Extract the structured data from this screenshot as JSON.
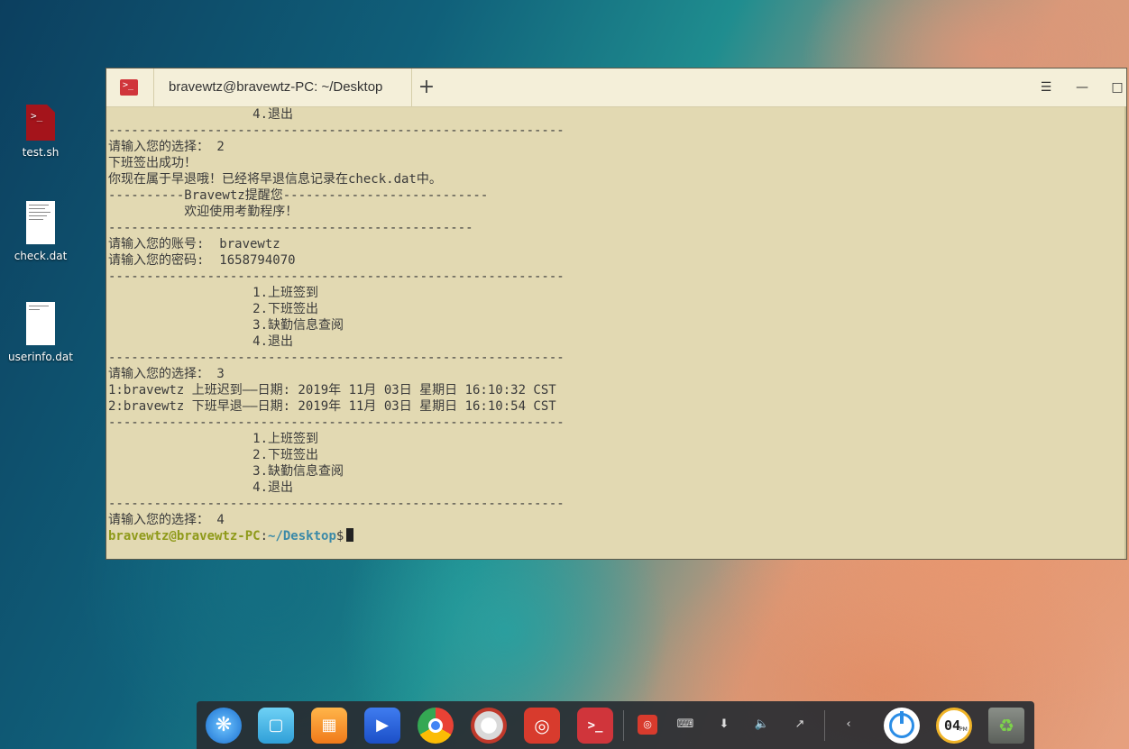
{
  "desktop": {
    "icons": [
      {
        "label": "test.sh"
      },
      {
        "label": "check.dat"
      },
      {
        "label": "userinfo.dat"
      }
    ]
  },
  "terminal": {
    "tab_title": "bravewtz@bravewtz-PC: ~/Desktop",
    "new_tab_symbol": "+",
    "lines": [
      "                   4.退出",
      "------------------------------------------------------------",
      "请输入您的选择： 2",
      "下班签出成功！",
      "你现在属于早退哦！已经将早退信息记录在check.dat中。",
      "----------Bravewtz提醒您---------------------------",
      "          欢迎使用考勤程序！",
      "------------------------------------------------",
      "请输入您的账号:  bravewtz",
      "请输入您的密码:  1658794070",
      "------------------------------------------------------------",
      "                   1.上班签到",
      "                   2.下班签出",
      "                   3.缺勤信息查阅",
      "                   4.退出",
      "------------------------------------------------------------",
      "请输入您的选择： 3",
      "1:bravewtz 上班迟到——日期: 2019年 11月 03日 星期日 16:10:32 CST",
      "2:bravewtz 下班早退——日期: 2019年 11月 03日 星期日 16:10:54 CST",
      "------------------------------------------------------------",
      "                   1.上班签到",
      "                   2.下班签出",
      "                   3.缺勤信息查阅",
      "                   4.退出",
      "------------------------------------------------------------",
      "请输入您的选择： 4"
    ],
    "prompt_user": "bravewtz@bravewtz-PC",
    "prompt_sep": ":",
    "prompt_path": "~/Desktop",
    "prompt_symbol": "$",
    "colors": {
      "background": "#e2d9b2",
      "text": "#3a3a3a",
      "user": "#8f9a1a",
      "path": "#3b8aa8"
    }
  },
  "dock": {
    "clock_text": "04",
    "clock_sub": "PM",
    "apps": [
      "launcher-icon",
      "file-manager-icon",
      "app-store-icon",
      "video-player-icon",
      "chrome-icon",
      "settings-icon",
      "netease-music-icon",
      "terminal-icon"
    ],
    "tray": [
      "netease-tray-icon",
      "keyboard-icon",
      "usb-icon",
      "volume-icon",
      "network-icon",
      "expand-tray-icon"
    ]
  }
}
